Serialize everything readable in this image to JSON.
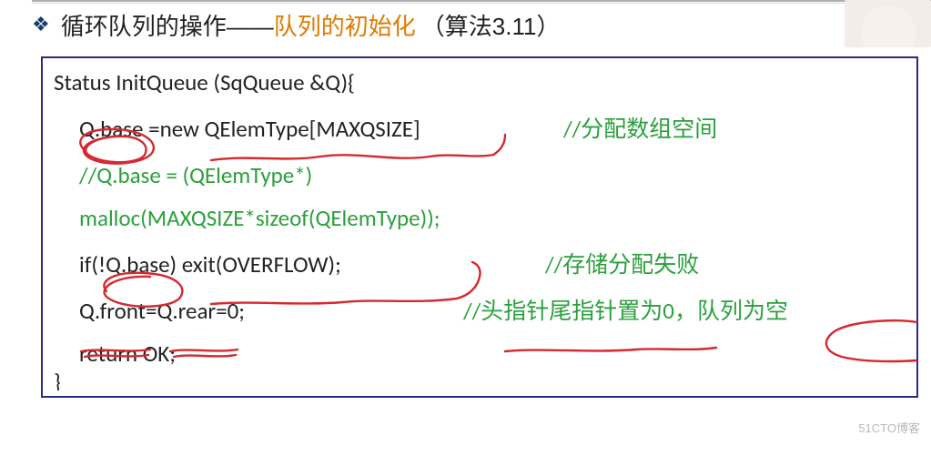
{
  "title": {
    "black1": "循环队列的操作——",
    "orange": "队列的初始化",
    "black2": "（算法3.11）"
  },
  "code": {
    "l1": "Status InitQueue (SqQueue &Q){",
    "l2a": "Q.base",
    "l2b": " =new QElemType[MAXQSIZE]",
    "l2c": "//分配数组空间",
    "l3": "//Q.base = (QElemType*)",
    "l4": "malloc(MAXQSIZE*sizeof(QElemType));",
    "l5a": "if(!Q.base) exit(OVERFLOW);",
    "l5c": "//存储分配失败",
    "l6a": "Q.front=Q.rear=0;",
    "l6c": "//头指针尾指针置为0，队列为空",
    "l7": "return OK;",
    "l8": "}"
  },
  "watermark": "51CTO博客",
  "annotations": {
    "stroke": "#d4292f",
    "width": 2.4
  }
}
